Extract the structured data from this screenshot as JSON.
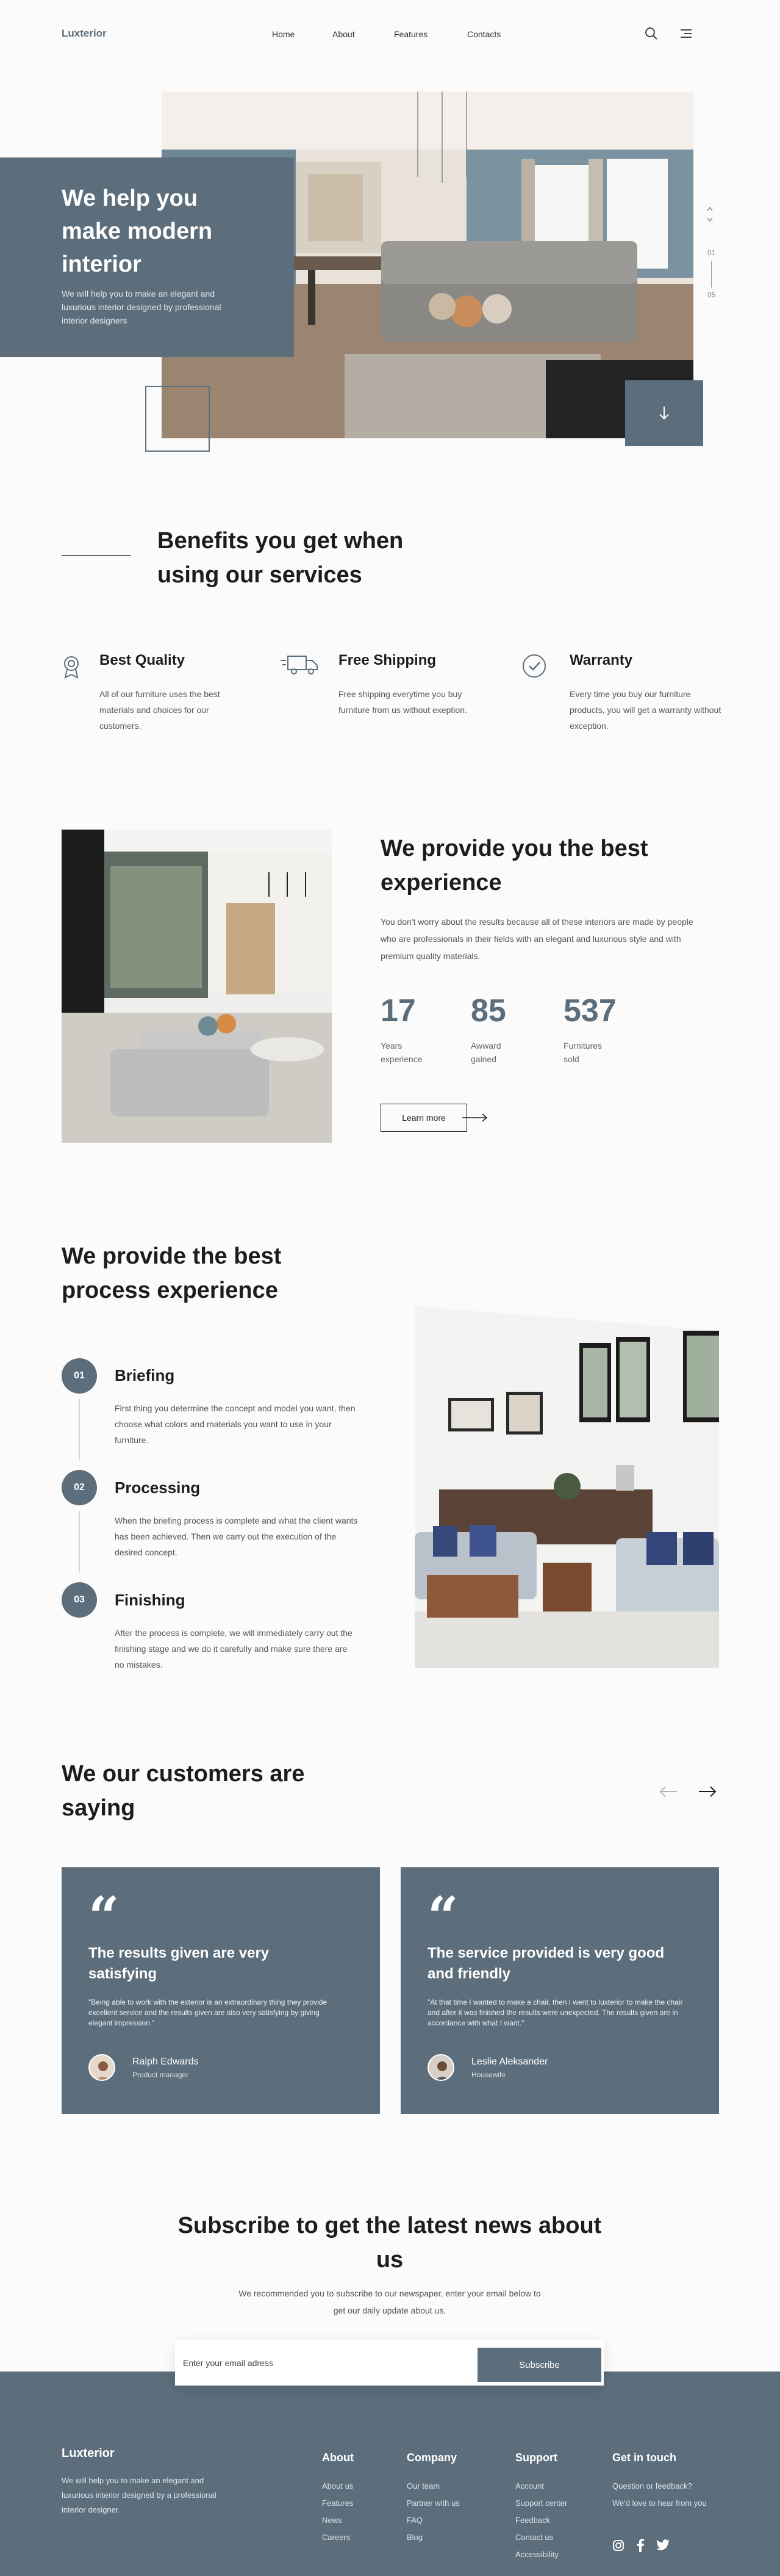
{
  "header": {
    "logo": "Luxterior",
    "nav": [
      "Home",
      "About",
      "Features",
      "Contacts"
    ],
    "icons": [
      "search-icon",
      "menu-icon"
    ]
  },
  "hero": {
    "title": "We help you make modern interior",
    "subtitle": "We will help you to make an elegant and luxurious interior designed by professional interior designers",
    "slide_current": "01",
    "slide_total": "05"
  },
  "benefits": {
    "title": "Benefits you get when using our services",
    "items": [
      {
        "title": "Best Quality",
        "text": "All of our furniture uses the best materials and choices for our customers.",
        "icon": "award-icon"
      },
      {
        "title": "Free Shipping",
        "text": "Free shipping everytime you buy furniture from us without exeption.",
        "icon": "truck-icon"
      },
      {
        "title": "Warranty",
        "text": "Every time you buy our furniture products, you will get a warranty without exception.",
        "icon": "check-badge-icon"
      }
    ]
  },
  "experience": {
    "title": "We provide you the best experience",
    "text": "You don't worry about the results because all of these interiors are made by people who are professionals in their fields with an elegant and luxurious style and with premium quality materials.",
    "stats": [
      {
        "value": "17",
        "label": "Years experience"
      },
      {
        "value": "85",
        "label": "Awward gained"
      },
      {
        "value": "537",
        "label": "Furnitures sold"
      }
    ],
    "button": "Learn more"
  },
  "process": {
    "title": "We provide  the best process experience",
    "steps": [
      {
        "num": "01",
        "title": "Briefing",
        "text": "First thing you determine the concept and model you want, then choose what colors and materials you want to use in your furniture."
      },
      {
        "num": "02",
        "title": "Processing",
        "text": "When the briefing process is complete and what the client wants has been achieved. Then we carry out the execution of the desired concept."
      },
      {
        "num": "03",
        "title": "Finishing",
        "text": "After the process is complete, we will immediately carry out the finishing stage and we do it carefully and make sure there are no mistakes."
      }
    ]
  },
  "testimonials": {
    "title": "We our customers are saying",
    "cards": [
      {
        "title": "The results given are very satisfying",
        "body": "\"Being able to work with the exterior is an extraordinary thing they provide excellent service and the results given are also very satisfying by giving elegant impression.\"",
        "name": "Ralph Edwards",
        "role": "Product manager"
      },
      {
        "title": "The service provided is very good and friendly",
        "body": "\"At that time I wanted to make a chair, then I went to luxterior to make the chair and after it was finished the results were unexpected. The results given are in accordance with what I want.\"",
        "name": "Leslie Aleksander",
        "role": "Housewife"
      }
    ]
  },
  "subscribe": {
    "title": "Subscribe to get the latest news about us",
    "text": "We recommended you to subscribe to our newspaper, enter your email below to get our daily update about us.",
    "placeholder": "Enter your email adress",
    "button": "Subscribe"
  },
  "footer": {
    "logo": "Luxterior",
    "desc": "We will help you to make an elegant and luxurious interior designed by a professional interior designer.",
    "columns": [
      {
        "title": "About",
        "links": [
          "About us",
          "Features",
          "News",
          "Careers"
        ]
      },
      {
        "title": "Company",
        "links": [
          "Our team",
          "Partner with us",
          "FAQ",
          "Blog"
        ]
      },
      {
        "title": "Support",
        "links": [
          "Account",
          "Support center",
          "Feedback",
          "Contact us",
          "Accessibility"
        ]
      },
      {
        "title": "Get in touch",
        "links": [
          "Question or feedback?",
          "We'd love to hear from you"
        ]
      }
    ],
    "social": [
      "instagram-icon",
      "facebook-icon",
      "twitter-icon"
    ]
  },
  "colors": {
    "accent": "#5c6e7b",
    "background": "#fbfbfb",
    "text": "#1d1d1f"
  }
}
